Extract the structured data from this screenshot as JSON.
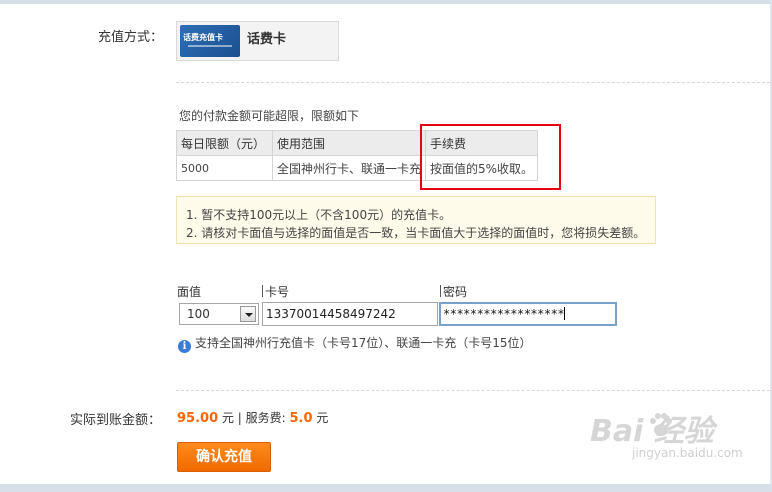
{
  "pay_method": {
    "label": "充值方式：",
    "card_image_text": "话费充值卡",
    "card_name": "话费卡"
  },
  "limits": {
    "note": "您的付款金额可能超限，限额如下",
    "headers": [
      "每日限额（元）",
      "使用范围",
      "手续费"
    ],
    "row": [
      "5000",
      "全国神州行卡、联通一卡充",
      "按面值的5%收取。"
    ]
  },
  "notice": {
    "line1": "1.  暂不支持100元以上（不含100元）的充值卡。",
    "line2": "2.  请核对卡面值与选择的面值是否一致，当卡面值大于选择的面值时，您将损失差额。"
  },
  "form": {
    "face_label": "面值",
    "card_label": "卡号",
    "pwd_label": "密码",
    "face_value": "100",
    "card_number": "13370014458497242",
    "password_mask": "******************",
    "hint": "支持全国神州行充值卡（卡号17位）、联通一卡充（卡号15位）"
  },
  "summary": {
    "label": "实际到账金额：",
    "amount": "95.00",
    "unit1": " 元 | 服务费: ",
    "fee": "5.0",
    "unit2": " 元"
  },
  "confirm_label": "确认充值",
  "watermark": {
    "main": "Bai  经验",
    "sub": "jingyan.baidu.com"
  },
  "colors": {
    "accent_orange": "#ff6600",
    "highlight_red": "#e60012",
    "notice_bg": "#fffbea"
  }
}
